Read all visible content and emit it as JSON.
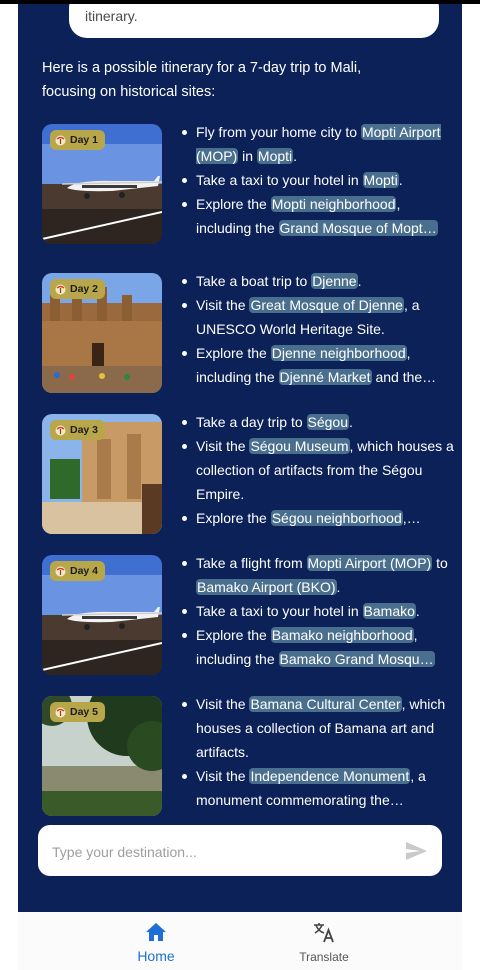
{
  "prev_message": "itinerary.",
  "intro": "Here is a possible itinerary for a 7-day trip to Mali, focusing on historical sites:",
  "days": [
    {
      "label": "Day 1",
      "bullets": [
        [
          {
            "t": "Fly from your home city to "
          },
          {
            "t": "Mopti Airport (MOP)",
            "h": true
          },
          {
            "t": " in "
          },
          {
            "t": "Mopti",
            "h": true
          },
          {
            "t": "."
          }
        ],
        [
          {
            "t": "Take a taxi to your hotel in "
          },
          {
            "t": "Mopti",
            "h": true
          },
          {
            "t": "."
          }
        ],
        [
          {
            "t": "Explore the "
          },
          {
            "t": "Mopti neighborhood",
            "h": true
          },
          {
            "t": ", including the "
          },
          {
            "t": "Grand Mosque of Mopt…",
            "h": true
          }
        ]
      ]
    },
    {
      "label": "Day 2",
      "bullets": [
        [
          {
            "t": "Take a boat trip to "
          },
          {
            "t": "Djenne",
            "h": true
          },
          {
            "t": "."
          }
        ],
        [
          {
            "t": "Visit the "
          },
          {
            "t": "Great Mosque of Djenne",
            "h": true
          },
          {
            "t": ", a UNESCO World Heritage Site."
          }
        ],
        [
          {
            "t": "Explore the "
          },
          {
            "t": "Djenne neighborhood",
            "h": true
          },
          {
            "t": ", including the "
          },
          {
            "t": "Djenné Market",
            "h": true
          },
          {
            "t": " and the…"
          }
        ]
      ]
    },
    {
      "label": "Day 3",
      "bullets": [
        [
          {
            "t": "Take a day trip to "
          },
          {
            "t": "Ségou",
            "h": true
          },
          {
            "t": "."
          }
        ],
        [
          {
            "t": "Visit the "
          },
          {
            "t": "Ségou Museum",
            "h": true
          },
          {
            "t": ", which houses a collection of artifacts from the Ségou Empire."
          }
        ],
        [
          {
            "t": "Explore the "
          },
          {
            "t": "Ségou neighborhood",
            "h": true
          },
          {
            "t": ",…"
          }
        ]
      ]
    },
    {
      "label": "Day 4",
      "bullets": [
        [
          {
            "t": "Take a flight from "
          },
          {
            "t": "Mopti Airport (MOP)",
            "h": true
          },
          {
            "t": " to "
          },
          {
            "t": "Bamako Airport (BKO)",
            "h": true
          },
          {
            "t": "."
          }
        ],
        [
          {
            "t": "Take a taxi to your hotel in "
          },
          {
            "t": "Bamako",
            "h": true
          },
          {
            "t": "."
          }
        ],
        [
          {
            "t": "Explore the "
          },
          {
            "t": "Bamako neighborhood",
            "h": true
          },
          {
            "t": ", including the "
          },
          {
            "t": "Bamako Grand Mosqu…",
            "h": true
          }
        ]
      ]
    },
    {
      "label": "Day 5",
      "bullets": [
        [
          {
            "t": "Visit the "
          },
          {
            "t": "Bamana Cultural Center",
            "h": true
          },
          {
            "t": ", which houses a collection of Bamana art and artifacts."
          }
        ],
        [
          {
            "t": "Visit the "
          },
          {
            "t": "Independence Monument",
            "h": true
          },
          {
            "t": ", a monument commemorating the…"
          }
        ]
      ]
    }
  ],
  "input": {
    "placeholder": "Type your destination..."
  },
  "nav": {
    "home": "Home",
    "translate": "Translate"
  },
  "colors": {
    "panel": "#0b2157",
    "highlight": "#4a6f8e",
    "badge": "#b8a64a",
    "nav_active": "#1b6fd6"
  },
  "icons": {
    "send": "send-icon",
    "home": "home-icon",
    "translate": "translate-icon",
    "badge": "palm-tree-icon"
  }
}
